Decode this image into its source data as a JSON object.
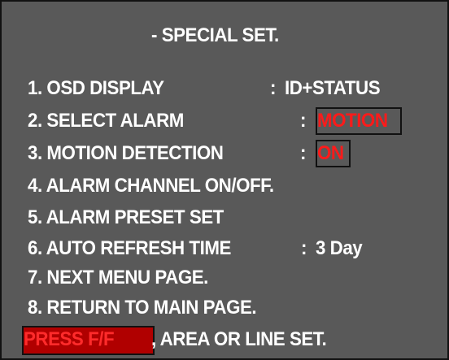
{
  "screen": {
    "title": "- SPECIAL SET.",
    "background_color": "#595959",
    "highlight_color": "#ff1a1a"
  },
  "menu": {
    "items": [
      {
        "label": "1. OSD DISPLAY",
        "separator": ": ",
        "value": "ID+STATUS"
      },
      {
        "label": "2. SELECT ALARM",
        "separator": ":",
        "value": "MOTION"
      },
      {
        "label": "3. MOTION DETECTION",
        "separator": ":",
        "value": "ON"
      },
      {
        "label": "4. ALARM CHANNEL ON/OFF."
      },
      {
        "label": "5. ALARM PRESET SET"
      },
      {
        "label": "6. AUTO REFRESH TIME",
        "separator": ": ",
        "value": "3 Day"
      },
      {
        "label": "7. NEXT MENU PAGE."
      },
      {
        "label": "8. RETURN TO MAIN PAGE."
      }
    ]
  },
  "footer": {
    "key_hint": "PRESS F/F",
    "text": ", AREA OR LINE SET."
  }
}
